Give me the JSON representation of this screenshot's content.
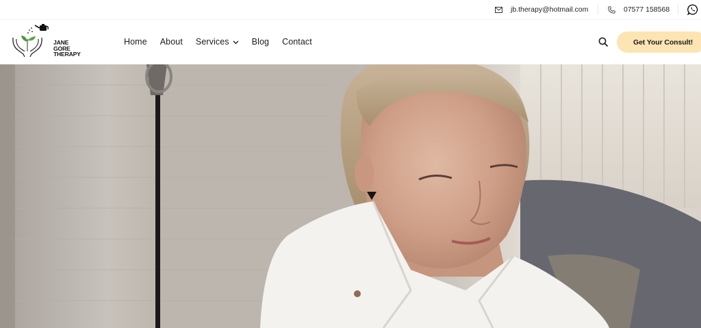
{
  "topbar": {
    "email": "jb.therapy@hotmail.com",
    "phone": "07577 158568",
    "icons": [
      "mail-icon",
      "phone-icon",
      "whatsapp-icon"
    ]
  },
  "header": {
    "logo": {
      "line1": "JANE GORE",
      "line2": "THERAPY"
    },
    "nav": {
      "home": "Home",
      "about": "About",
      "services": "Services",
      "blog": "Blog",
      "contact": "Contact"
    },
    "cta_label": "Get Your Consult!"
  },
  "colors": {
    "cta_bg": "#fce5b3",
    "logo_green": "#4c9a3c"
  },
  "hero": {
    "image_alt": "Woman in a white shirt sitting in a room"
  }
}
